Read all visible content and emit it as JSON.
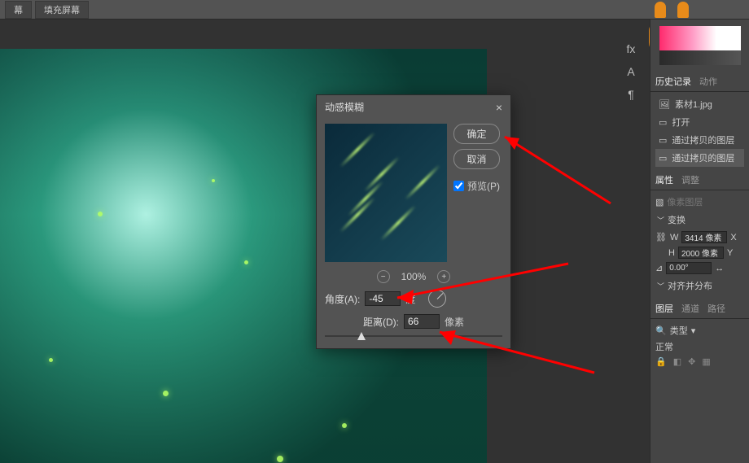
{
  "topbar": {
    "btn1": "幕",
    "btn2": "填充屏幕"
  },
  "dialog": {
    "title": "动感模糊",
    "ok": "确定",
    "cancel": "取消",
    "preview": "预览(P)",
    "zoom": "100%",
    "angle_label": "角度(A):",
    "angle_value": "-45",
    "angle_unit": "度",
    "distance_label": "距离(D):",
    "distance_value": "66",
    "distance_unit": "像素"
  },
  "history": {
    "tab1": "历史记录",
    "tab2": "动作",
    "items": [
      "素材1.jpg",
      "打开",
      "通过拷贝的图层",
      "通过拷贝的图层"
    ]
  },
  "properties": {
    "tab1": "属性",
    "tab2": "调整",
    "placeholder": "像素图层",
    "transform_header": "变换",
    "w_label": "W",
    "w_value": "3414 像素",
    "w_axis": "X",
    "h_label": "H",
    "h_value": "2000 像素",
    "h_axis": "Y",
    "rotation": "0.00°",
    "align_header": "对齐并分布"
  },
  "layers": {
    "tab1": "图层",
    "tab2": "通道",
    "tab3": "路径",
    "type": "类型",
    "mode": "正常"
  }
}
